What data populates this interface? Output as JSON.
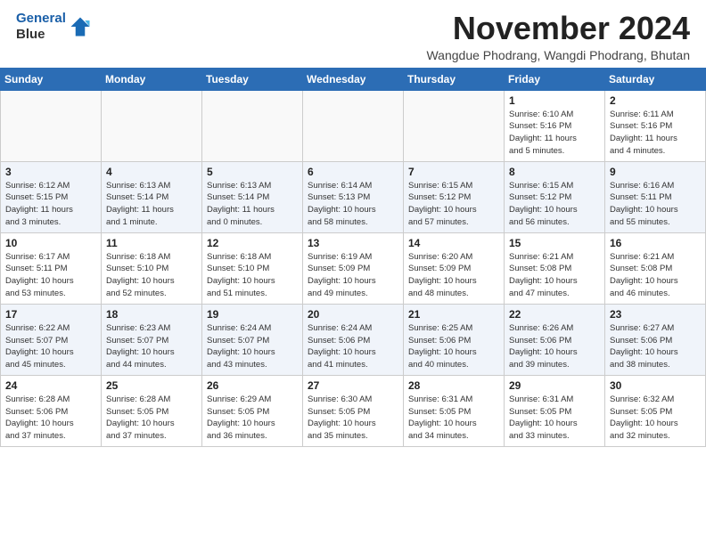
{
  "header": {
    "logo_line1": "General",
    "logo_line2": "Blue",
    "month": "November 2024",
    "location": "Wangdue Phodrang, Wangdi Phodrang, Bhutan"
  },
  "weekdays": [
    "Sunday",
    "Monday",
    "Tuesday",
    "Wednesday",
    "Thursday",
    "Friday",
    "Saturday"
  ],
  "weeks": [
    [
      {
        "day": "",
        "info": ""
      },
      {
        "day": "",
        "info": ""
      },
      {
        "day": "",
        "info": ""
      },
      {
        "day": "",
        "info": ""
      },
      {
        "day": "",
        "info": ""
      },
      {
        "day": "1",
        "info": "Sunrise: 6:10 AM\nSunset: 5:16 PM\nDaylight: 11 hours\nand 5 minutes."
      },
      {
        "day": "2",
        "info": "Sunrise: 6:11 AM\nSunset: 5:16 PM\nDaylight: 11 hours\nand 4 minutes."
      }
    ],
    [
      {
        "day": "3",
        "info": "Sunrise: 6:12 AM\nSunset: 5:15 PM\nDaylight: 11 hours\nand 3 minutes."
      },
      {
        "day": "4",
        "info": "Sunrise: 6:13 AM\nSunset: 5:14 PM\nDaylight: 11 hours\nand 1 minute."
      },
      {
        "day": "5",
        "info": "Sunrise: 6:13 AM\nSunset: 5:14 PM\nDaylight: 11 hours\nand 0 minutes."
      },
      {
        "day": "6",
        "info": "Sunrise: 6:14 AM\nSunset: 5:13 PM\nDaylight: 10 hours\nand 58 minutes."
      },
      {
        "day": "7",
        "info": "Sunrise: 6:15 AM\nSunset: 5:12 PM\nDaylight: 10 hours\nand 57 minutes."
      },
      {
        "day": "8",
        "info": "Sunrise: 6:15 AM\nSunset: 5:12 PM\nDaylight: 10 hours\nand 56 minutes."
      },
      {
        "day": "9",
        "info": "Sunrise: 6:16 AM\nSunset: 5:11 PM\nDaylight: 10 hours\nand 55 minutes."
      }
    ],
    [
      {
        "day": "10",
        "info": "Sunrise: 6:17 AM\nSunset: 5:11 PM\nDaylight: 10 hours\nand 53 minutes."
      },
      {
        "day": "11",
        "info": "Sunrise: 6:18 AM\nSunset: 5:10 PM\nDaylight: 10 hours\nand 52 minutes."
      },
      {
        "day": "12",
        "info": "Sunrise: 6:18 AM\nSunset: 5:10 PM\nDaylight: 10 hours\nand 51 minutes."
      },
      {
        "day": "13",
        "info": "Sunrise: 6:19 AM\nSunset: 5:09 PM\nDaylight: 10 hours\nand 49 minutes."
      },
      {
        "day": "14",
        "info": "Sunrise: 6:20 AM\nSunset: 5:09 PM\nDaylight: 10 hours\nand 48 minutes."
      },
      {
        "day": "15",
        "info": "Sunrise: 6:21 AM\nSunset: 5:08 PM\nDaylight: 10 hours\nand 47 minutes."
      },
      {
        "day": "16",
        "info": "Sunrise: 6:21 AM\nSunset: 5:08 PM\nDaylight: 10 hours\nand 46 minutes."
      }
    ],
    [
      {
        "day": "17",
        "info": "Sunrise: 6:22 AM\nSunset: 5:07 PM\nDaylight: 10 hours\nand 45 minutes."
      },
      {
        "day": "18",
        "info": "Sunrise: 6:23 AM\nSunset: 5:07 PM\nDaylight: 10 hours\nand 44 minutes."
      },
      {
        "day": "19",
        "info": "Sunrise: 6:24 AM\nSunset: 5:07 PM\nDaylight: 10 hours\nand 43 minutes."
      },
      {
        "day": "20",
        "info": "Sunrise: 6:24 AM\nSunset: 5:06 PM\nDaylight: 10 hours\nand 41 minutes."
      },
      {
        "day": "21",
        "info": "Sunrise: 6:25 AM\nSunset: 5:06 PM\nDaylight: 10 hours\nand 40 minutes."
      },
      {
        "day": "22",
        "info": "Sunrise: 6:26 AM\nSunset: 5:06 PM\nDaylight: 10 hours\nand 39 minutes."
      },
      {
        "day": "23",
        "info": "Sunrise: 6:27 AM\nSunset: 5:06 PM\nDaylight: 10 hours\nand 38 minutes."
      }
    ],
    [
      {
        "day": "24",
        "info": "Sunrise: 6:28 AM\nSunset: 5:06 PM\nDaylight: 10 hours\nand 37 minutes."
      },
      {
        "day": "25",
        "info": "Sunrise: 6:28 AM\nSunset: 5:05 PM\nDaylight: 10 hours\nand 37 minutes."
      },
      {
        "day": "26",
        "info": "Sunrise: 6:29 AM\nSunset: 5:05 PM\nDaylight: 10 hours\nand 36 minutes."
      },
      {
        "day": "27",
        "info": "Sunrise: 6:30 AM\nSunset: 5:05 PM\nDaylight: 10 hours\nand 35 minutes."
      },
      {
        "day": "28",
        "info": "Sunrise: 6:31 AM\nSunset: 5:05 PM\nDaylight: 10 hours\nand 34 minutes."
      },
      {
        "day": "29",
        "info": "Sunrise: 6:31 AM\nSunset: 5:05 PM\nDaylight: 10 hours\nand 33 minutes."
      },
      {
        "day": "30",
        "info": "Sunrise: 6:32 AM\nSunset: 5:05 PM\nDaylight: 10 hours\nand 32 minutes."
      }
    ]
  ]
}
